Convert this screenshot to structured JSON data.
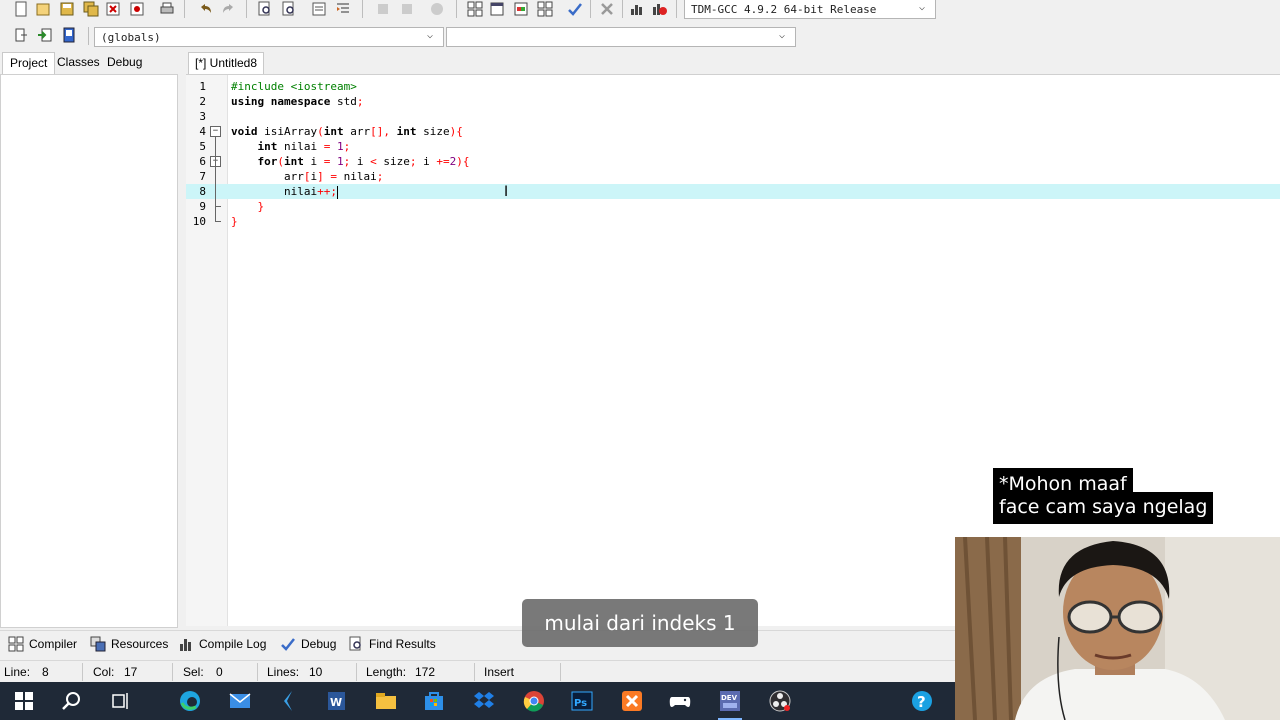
{
  "toolbar": {
    "compiler_select": "TDM-GCC 4.9.2 64-bit Release",
    "scope_select": "(globals)",
    "function_select": ""
  },
  "left_panel": {
    "tabs": [
      "Project",
      "Classes",
      "Debug"
    ]
  },
  "editor": {
    "file_tab": "[*] Untitled8",
    "line_numbers": [
      "1",
      "2",
      "3",
      "4",
      "5",
      "6",
      "7",
      "8",
      "9",
      "10"
    ]
  },
  "bottom_tabs": [
    "Compiler",
    "Resources",
    "Compile Log",
    "Debug",
    "Find Results"
  ],
  "status": {
    "line_label": "Line:",
    "line_value": "8",
    "col_label": "Col:",
    "col_value": "17",
    "sel_label": "Sel:",
    "sel_value": "0",
    "lines_label": "Lines:",
    "lines_value": "10",
    "length_label": "Length:",
    "length_value": "172",
    "mode": "Insert"
  },
  "overlay": {
    "subtitle": "mulai dari indeks 1",
    "note_line1": "*Mohon maaf",
    "note_line2": "face cam saya ngelag"
  },
  "taskbar_icons": [
    "windows-start-icon",
    "search-icon",
    "task-view-icon",
    "edge-icon",
    "mail-icon",
    "visual-studio-icon",
    "word-icon",
    "file-explorer-icon",
    "store-icon",
    "dropbox-icon",
    "chrome-icon",
    "photoshop-icon",
    "xampp-icon",
    "gamepad-icon",
    "devcpp-icon",
    "obs-icon",
    "help-icon"
  ]
}
